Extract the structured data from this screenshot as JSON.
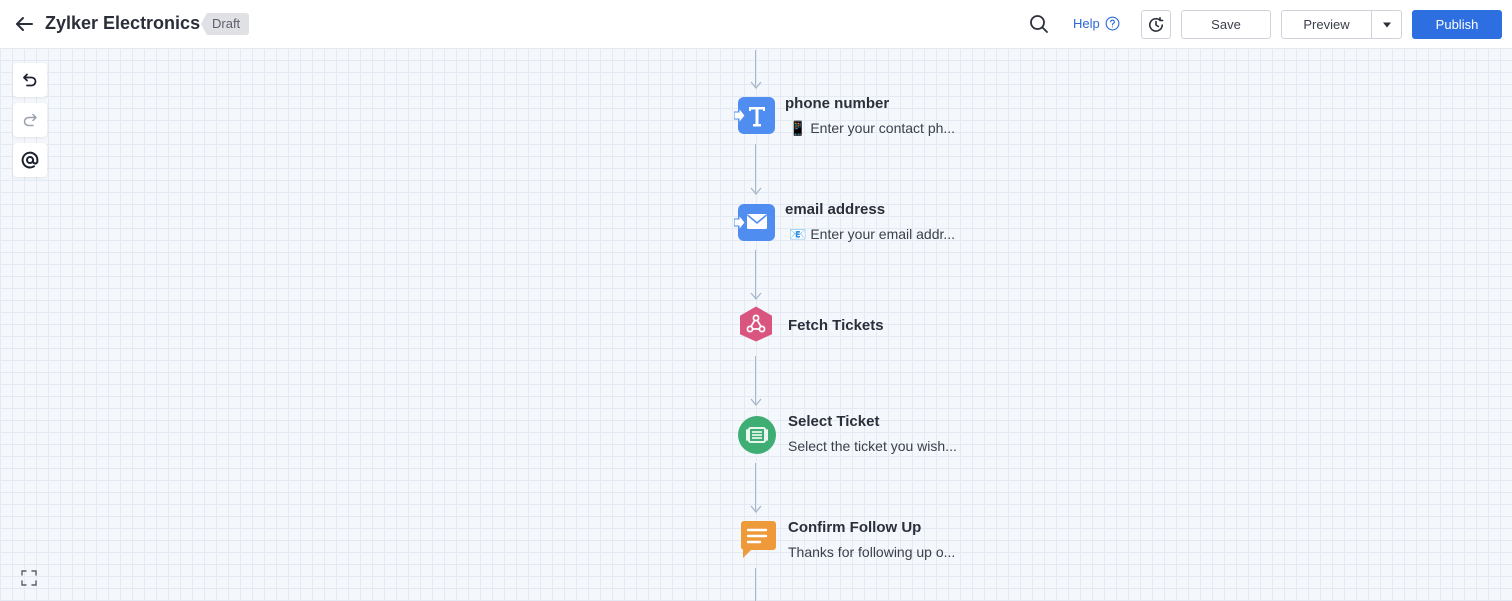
{
  "header": {
    "title": "Zylker Electronics",
    "status_badge": "Draft",
    "help_label": "Help",
    "save_label": "Save",
    "preview_label": "Preview",
    "publish_label": "Publish"
  },
  "icons": {
    "back": "arrow-left-icon",
    "search": "search-icon",
    "help": "question-circle-icon",
    "history": "history-icon",
    "dropdown": "caret-down-icon",
    "undo": "undo-icon",
    "redo": "redo-icon",
    "mention": "at-sign-icon",
    "fullscreen": "fullscreen-icon"
  },
  "colors": {
    "accent": "#2d6fe0",
    "input_node": "#4f8ef0",
    "webhook_node": "#d9547f",
    "select_node": "#3fae74",
    "message_node": "#ee9a3b"
  },
  "flow": {
    "nodes": [
      {
        "title": "phone number",
        "subtitle": "📱 Enter your contact ph...",
        "type": "text-input"
      },
      {
        "title": "email address",
        "subtitle": "📧 Enter your email addr...",
        "type": "email-input"
      },
      {
        "title": "Fetch Tickets",
        "subtitle": "",
        "type": "webhook"
      },
      {
        "title": "Select Ticket",
        "subtitle": "Select the ticket you wish...",
        "type": "select"
      },
      {
        "title": "Confirm Follow Up",
        "subtitle": "Thanks for following up o...",
        "type": "message"
      }
    ]
  }
}
